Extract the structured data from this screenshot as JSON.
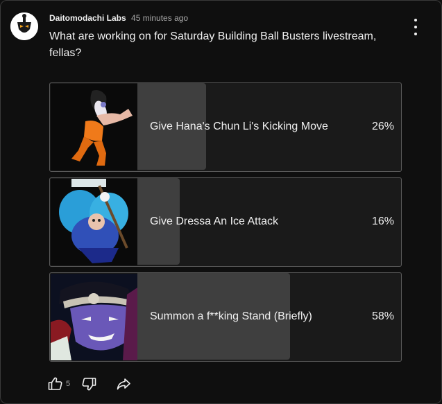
{
  "post": {
    "author": "Daitomodachi Labs",
    "time": "45 minutes ago",
    "text": "What are working on for Saturday Building Ball Busters livestream, fellas?"
  },
  "poll": {
    "options": [
      {
        "label": "Give Hana's Chun Li's Kicking Move",
        "percent": "26%",
        "fraction": 0.26,
        "image": "hana-character-art"
      },
      {
        "label": "Give Dressa An Ice Attack",
        "percent": "16%",
        "fraction": 0.16,
        "image": "dressa-character-art"
      },
      {
        "label": "Summon a f**king Stand (Briefly)",
        "percent": "58%",
        "fraction": 0.58,
        "image": "stand-character-art"
      }
    ]
  },
  "actions": {
    "like_count": "5",
    "icons": [
      "thumbs-up-icon",
      "thumbs-down-icon",
      "share-icon"
    ]
  },
  "colors": {
    "background": "#0f0f0f",
    "option_bg": "#1a1a1a",
    "bar": "#3f3f3f",
    "text": "#f1f1f1",
    "muted": "#aaaaaa"
  }
}
